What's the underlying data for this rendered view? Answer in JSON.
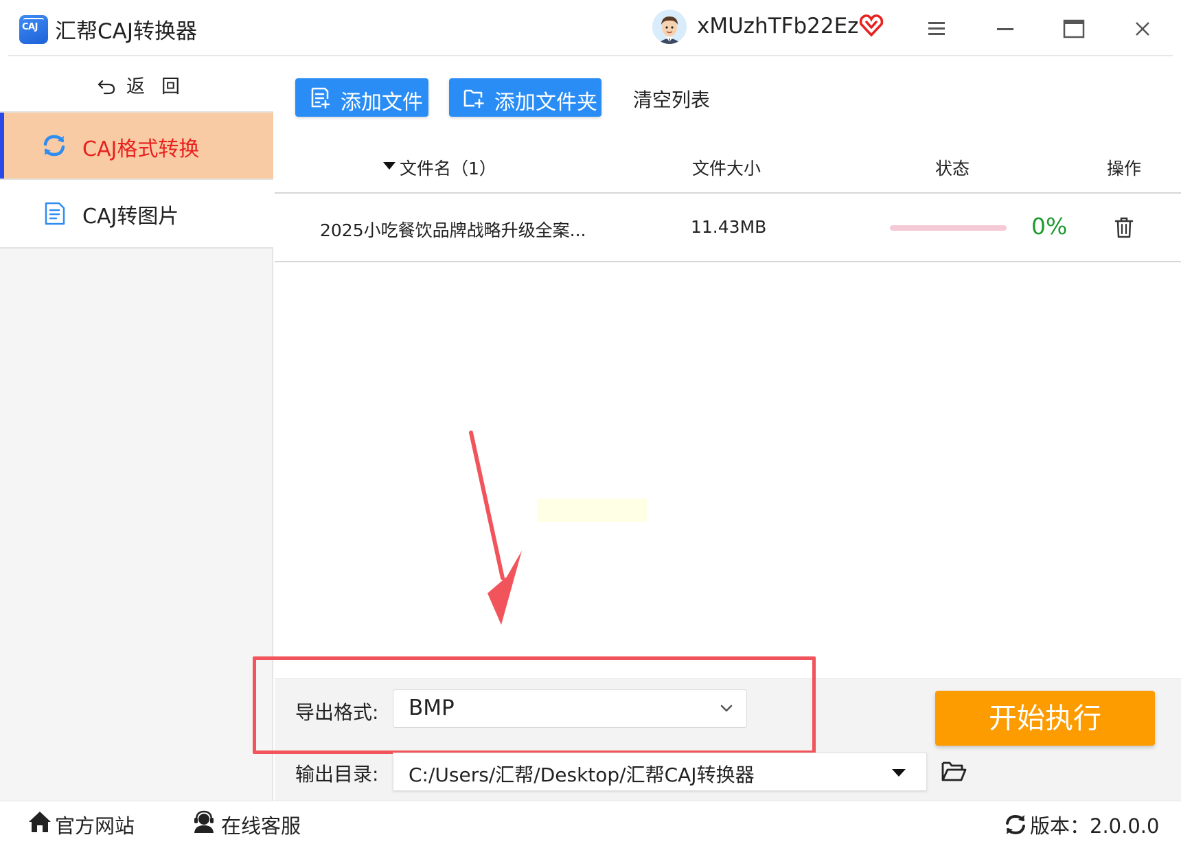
{
  "app": {
    "logo_text": "CAJ",
    "title": "汇帮CAJ转换器"
  },
  "user": {
    "name": "xMUzhTFb22Ez"
  },
  "sidebar": {
    "back_label": "返回",
    "items": [
      {
        "label": "CAJ格式转换",
        "active": true
      },
      {
        "label": "CAJ转图片",
        "active": false
      }
    ]
  },
  "toolbar": {
    "add_file": "添加文件",
    "add_folder": "添加文件夹",
    "clear_list": "清空列表"
  },
  "table": {
    "columns": {
      "filename": "文件名（1）",
      "size": "文件大小",
      "status": "状态",
      "action": "操作"
    },
    "rows": [
      {
        "filename": "2025小吃餐饮品牌战略升级全案...",
        "size": "11.43MB",
        "progress_percent": 0,
        "progress_text": "0%"
      }
    ]
  },
  "bottom": {
    "export_format_label": "导出格式:",
    "export_format_value": "BMP",
    "output_dir_label": "输出目录:",
    "output_dir_value": "C:/Users/汇帮/Desktop/汇帮CAJ转换器",
    "start_button": "开始执行"
  },
  "footer": {
    "official_site": "官方网站",
    "support": "在线客服",
    "version": "版本：2.0.0.0"
  },
  "colors": {
    "accent_blue": "#2a8df5",
    "active_nav_bg": "#f8cba4",
    "active_nav_text": "#e8211f",
    "start_orange": "#fd9c00",
    "highlight_red": "#f2545b",
    "progress_green": "#1e9a2e"
  }
}
